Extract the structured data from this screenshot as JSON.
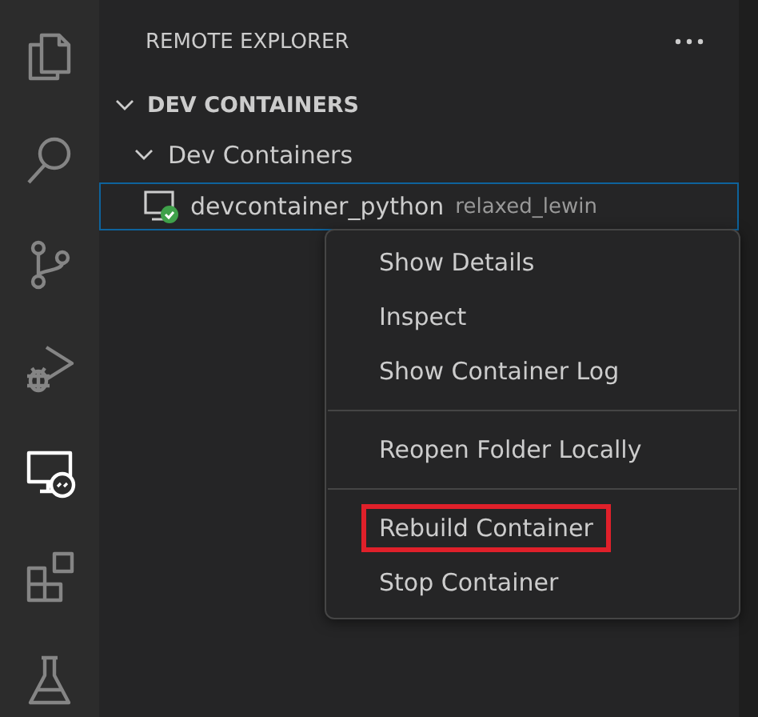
{
  "activity_bar": {
    "items": [
      {
        "kind": "files",
        "selected": false
      },
      {
        "kind": "search",
        "selected": false
      },
      {
        "kind": "source-control",
        "selected": false
      },
      {
        "kind": "run-debug",
        "selected": false
      },
      {
        "kind": "remote",
        "selected": true
      },
      {
        "kind": "extensions",
        "selected": false
      },
      {
        "kind": "testing",
        "selected": false
      }
    ]
  },
  "sidebar": {
    "title": "REMOTE EXPLORER",
    "section": {
      "title": "DEV CONTAINERS",
      "expanded": true,
      "groups": [
        {
          "label": "Dev Containers",
          "expanded": true,
          "children": [
            {
              "name": "devcontainer_python",
              "detail": "relaxed_lewin",
              "running": true,
              "focused": true
            }
          ]
        }
      ]
    }
  },
  "context_menu": {
    "groups": [
      {
        "items": [
          {
            "label": "Show Details",
            "highlighted": false
          },
          {
            "label": "Inspect",
            "highlighted": false
          },
          {
            "label": "Show Container Log",
            "highlighted": false
          }
        ]
      },
      {
        "items": [
          {
            "label": "Reopen Folder Locally",
            "highlighted": false
          }
        ]
      },
      {
        "items": [
          {
            "label": "Rebuild Container",
            "highlighted": true
          },
          {
            "label": "Stop Container",
            "highlighted": false
          }
        ]
      }
    ]
  }
}
